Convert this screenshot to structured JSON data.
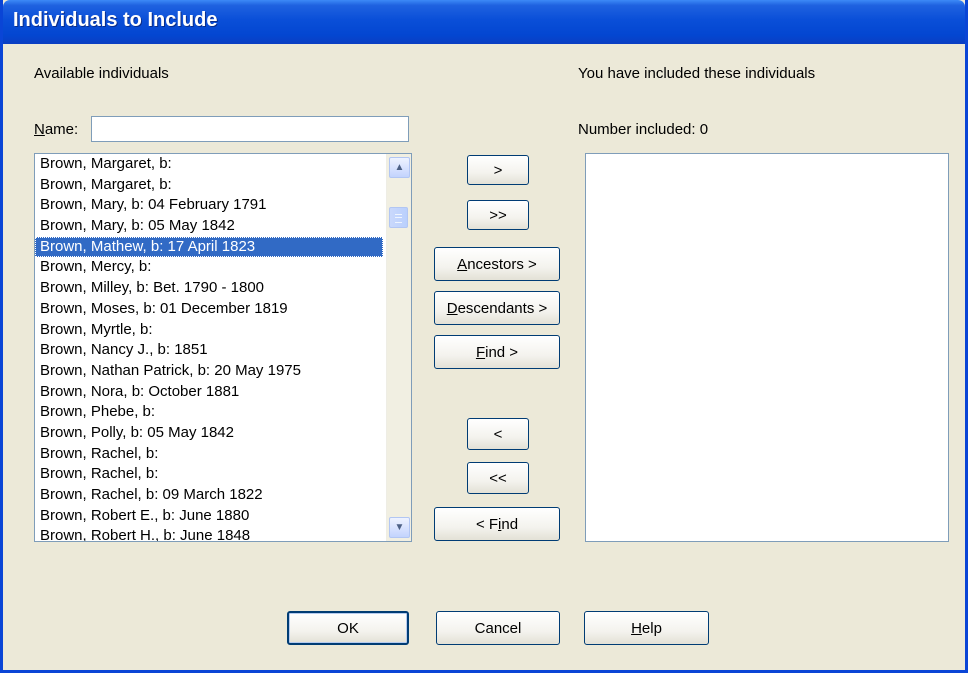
{
  "window": {
    "title": "Individuals to Include"
  },
  "available": {
    "heading": "Available individuals",
    "name_label_key": "N",
    "name_label_rest": "ame:",
    "name_value": "",
    "items": [
      "Brown, Margaret, b:",
      "Brown, Margaret, b:",
      "Brown, Mary, b: 04 February 1791",
      "Brown, Mary, b: 05 May 1842",
      "Brown, Mathew, b: 17 April 1823",
      "Brown, Mercy, b:",
      "Brown, Milley, b: Bet. 1790 - 1800",
      "Brown, Moses, b: 01 December 1819",
      "Brown, Myrtle, b:",
      "Brown, Nancy J., b: 1851",
      "Brown, Nathan Patrick, b: 20 May 1975",
      "Brown, Nora, b: October 1881",
      "Brown, Phebe, b:",
      "Brown, Polly, b: 05 May 1842",
      "Brown, Rachel, b:",
      "Brown, Rachel, b:",
      "Brown, Rachel, b: 09 March 1822",
      "Brown, Robert E., b: June 1880",
      "Brown, Robert H., b: June 1848"
    ],
    "selected_index": 4
  },
  "included": {
    "heading": "You have included these individuals",
    "count_label": "Number included:",
    "count": "0"
  },
  "buttons": {
    "add_one": ">",
    "add_all": ">>",
    "ancestors_key": "A",
    "ancestors_rest": "ncestors >",
    "descendants_key": "D",
    "descendants_rest": "escendants >",
    "find_key": "F",
    "find_rest": "ind >",
    "remove_one": "<",
    "remove_all": "<<",
    "find_back_pre": "< F",
    "find_back_key": "i",
    "find_back_rest": "nd",
    "ok": "OK",
    "cancel": "Cancel",
    "help_key": "H",
    "help_rest": "elp"
  },
  "icons": {
    "scroll_up": "▲",
    "scroll_down": "▼"
  },
  "colors": {
    "titlebar": "#0a4fd8",
    "selection": "#316ac5",
    "dialog_bg": "#ece9d8"
  }
}
